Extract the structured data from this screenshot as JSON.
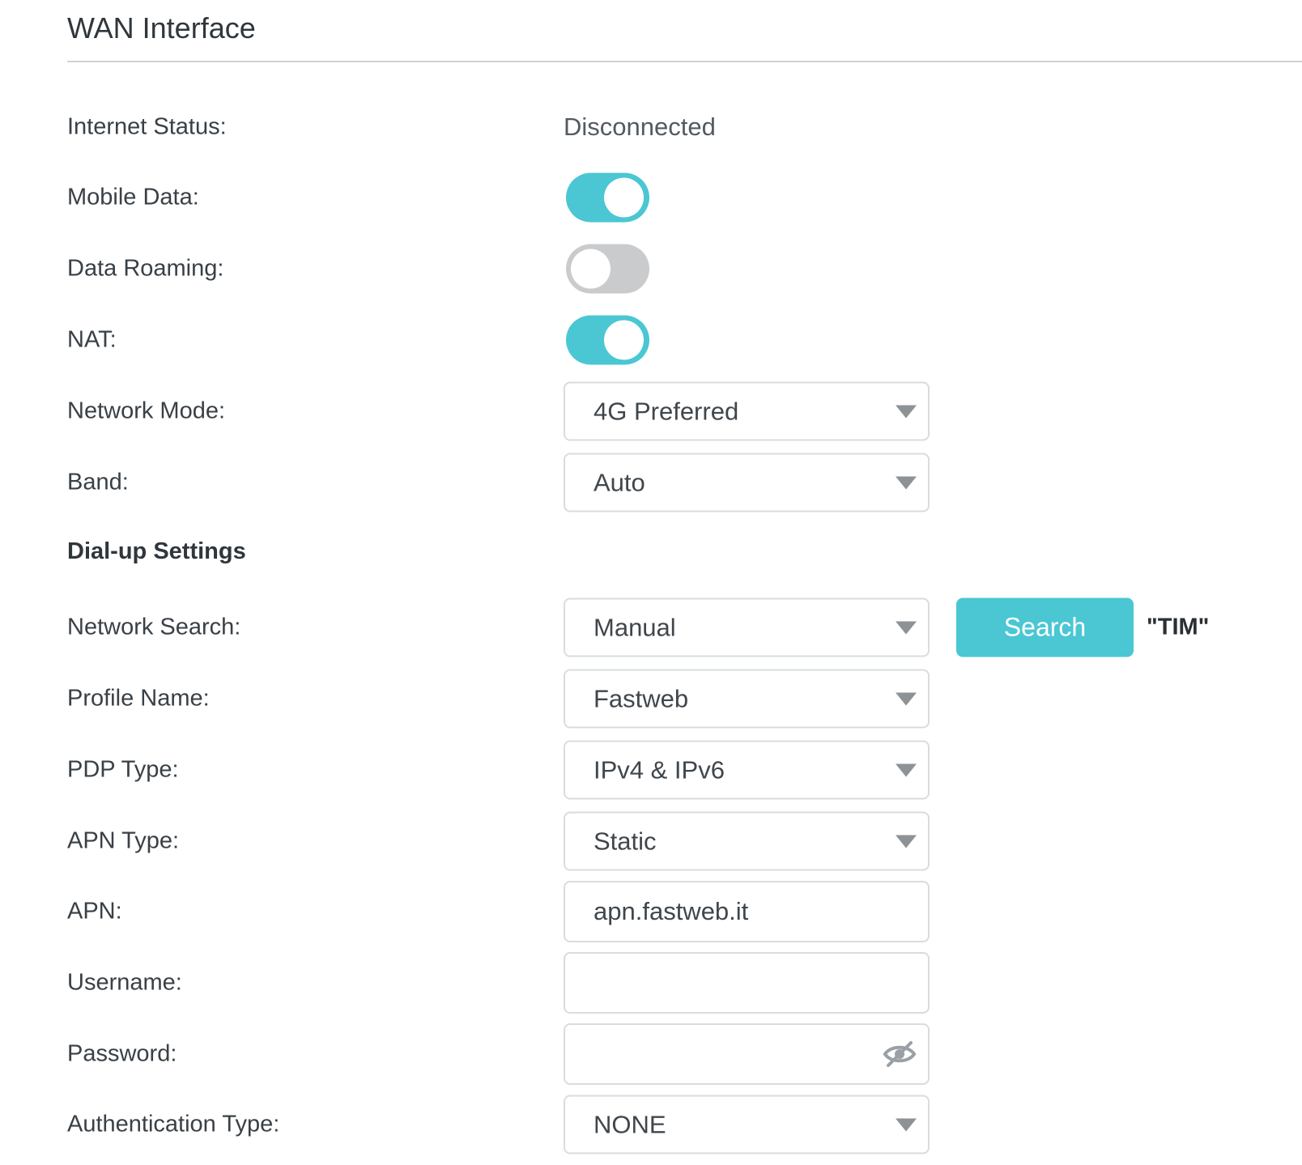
{
  "section": {
    "title": "WAN Interface"
  },
  "internet_status": {
    "label": "Internet Status:",
    "value": "Disconnected"
  },
  "mobile_data": {
    "label": "Mobile Data:",
    "enabled": true
  },
  "data_roaming": {
    "label": "Data Roaming:",
    "enabled": false
  },
  "nat": {
    "label": "NAT:",
    "enabled": true
  },
  "network_mode": {
    "label": "Network Mode:",
    "value": "4G Preferred"
  },
  "band": {
    "label": "Band:",
    "value": "Auto"
  },
  "dialup": {
    "title": "Dial-up Settings"
  },
  "network_search": {
    "label": "Network Search:",
    "value": "Manual",
    "button_label": "Search",
    "selected_network": "\"TIM\""
  },
  "profile_name": {
    "label": "Profile Name:",
    "value": "Fastweb"
  },
  "pdp_type": {
    "label": "PDP Type:",
    "value": "IPv4 & IPv6"
  },
  "apn_type": {
    "label": "APN Type:",
    "value": "Static"
  },
  "apn": {
    "label": "APN:",
    "value": "apn.fastweb.it"
  },
  "username": {
    "label": "Username:",
    "value": ""
  },
  "password": {
    "label": "Password:",
    "value": "",
    "visibility_icon": "eye-off-icon"
  },
  "authentication_type": {
    "label": "Authentication Type:",
    "value": "NONE"
  },
  "colors": {
    "accent": "#4ac7d3",
    "toggle_off": "#c9cbcd"
  }
}
